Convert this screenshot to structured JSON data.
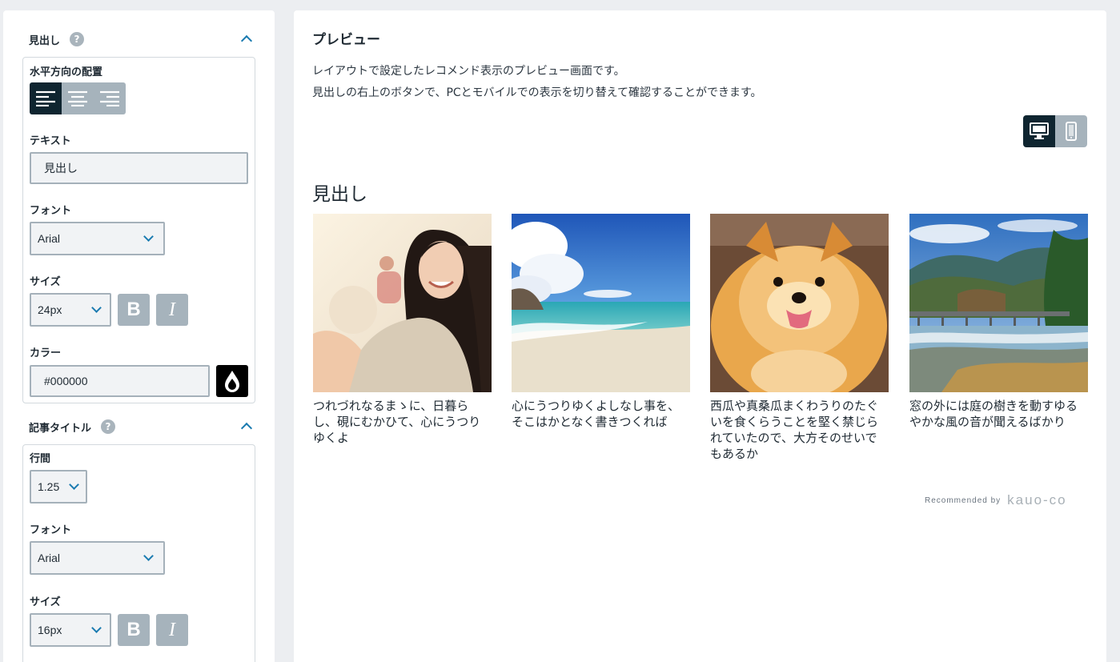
{
  "sidebar": {
    "heading_section": {
      "title": "見出し",
      "help": "?",
      "align_label": "水平方向の配置",
      "text_label": "テキスト",
      "text_value": "見出し",
      "font_label": "フォント",
      "font_value": "Arial",
      "size_label": "サイズ",
      "size_value": "24px",
      "bold_label": "B",
      "italic_label": "I",
      "color_label": "カラー",
      "color_value": "#000000"
    },
    "article_title_section": {
      "title": "記事タイトル",
      "help": "?",
      "line_height_label": "行間",
      "line_height_value": "1.25",
      "font_label": "フォント",
      "font_value": "Arial",
      "size_label": "サイズ",
      "size_value": "16px",
      "bold_label": "B",
      "italic_label": "I"
    }
  },
  "preview": {
    "title": "プレビュー",
    "desc_line1": "レイアウトで設定したレコメンド表示のプレビュー画面です。",
    "desc_line2": "見出しの右上のボタンで、PCとモバイルでの表示を切り替えて確認することができます。",
    "heading": "見出し",
    "cards": [
      {
        "title": "つれづれなるまゝに、日暮らし、硯にむかひて、心にうつりゆくよ",
        "image": "smiling-woman"
      },
      {
        "title": "心にうつりゆくよしなし事を、そこはかとなく書きつくれば",
        "image": "tropical-beach"
      },
      {
        "title": "西瓜や真桑瓜まくわうりのたぐいを食くらうことを堅く禁じられていたので、大方そのせいでもあるか",
        "image": "pomeranian-dog"
      },
      {
        "title": "窓の外には庭の樹きを動すゆるやかな風の音が聞えるばかり",
        "image": "mountain-river-bridge"
      }
    ],
    "recommended_by": "Recommended by",
    "logo_text": "kauo-co"
  },
  "colors": {
    "accent": "#1a7bb0",
    "dark": "#0f2530",
    "button_gray": "#a6b3bc",
    "background": "#eceef1"
  }
}
